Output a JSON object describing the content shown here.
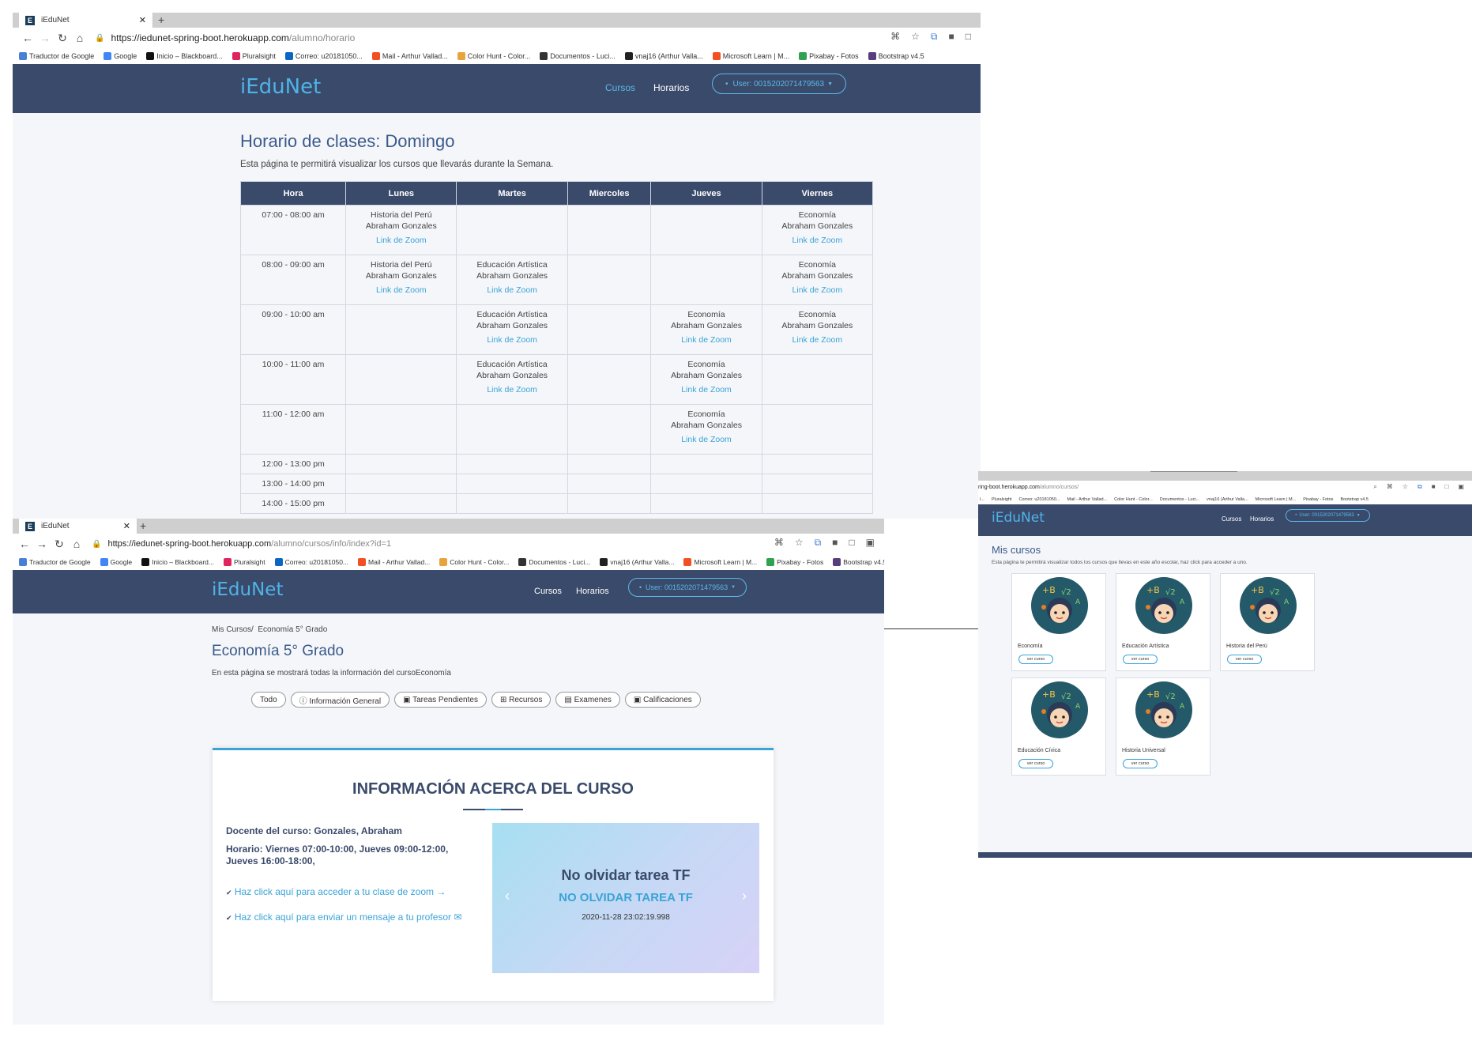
{
  "win1": {
    "tab_title": "iEduNet",
    "url_host": "https://iedunet-spring-boot.herokuapp.com",
    "url_path": "/alumno/horario",
    "bookmarks": [
      "Traductor de Google",
      "Google",
      "Inicio – Blackboard...",
      "Pluralsight",
      "Correo: u20181050...",
      "Mail - Arthur Vallad...",
      "Color Hunt - Color...",
      "Documentos - Luci...",
      "vnaj16 (Arthur Valla...",
      "Microsoft Learn | M...",
      "Pixabay - Fotos",
      "Bootstrap v4.5"
    ],
    "logo": "iEduNet",
    "nav_cursos": "Cursos",
    "nav_horarios": "Horarios",
    "user": "User: 0015202071479563",
    "title": "Horario de clases: Domingo",
    "desc": "Esta página te permitirá visualizar los cursos que llevarás durante la Semana.",
    "headers": [
      "Hora",
      "Lunes",
      "Martes",
      "Miercoles",
      "Jueves",
      "Viernes"
    ],
    "zoom_label": "Link de Zoom",
    "rows": [
      {
        "hora": "07:00 - 08:00 am",
        "cells": [
          [
            "Historia del Perú",
            "Abraham Gonzales"
          ],
          [],
          [],
          [],
          [
            "Economía",
            "Abraham Gonzales"
          ]
        ]
      },
      {
        "hora": "08:00 - 09:00 am",
        "cells": [
          [
            "Historia del Perú",
            "Abraham Gonzales"
          ],
          [
            "Educación Artística",
            "Abraham Gonzales"
          ],
          [],
          [],
          [
            "Economía",
            "Abraham Gonzales"
          ]
        ]
      },
      {
        "hora": "09:00 - 10:00 am",
        "cells": [
          [],
          [
            "Educación Artística",
            "Abraham Gonzales"
          ],
          [],
          [
            "Economía",
            "Abraham Gonzales"
          ],
          [
            "Economía",
            "Abraham Gonzales"
          ]
        ]
      },
      {
        "hora": "10:00 - 11:00 am",
        "cells": [
          [],
          [
            "Educación Artística",
            "Abraham Gonzales"
          ],
          [],
          [
            "Economía",
            "Abraham Gonzales"
          ],
          []
        ]
      },
      {
        "hora": "11:00 - 12:00 am",
        "cells": [
          [],
          [],
          [],
          [
            "Economía",
            "Abraham Gonzales"
          ],
          []
        ]
      },
      {
        "hora": "12:00 - 13:00 pm",
        "cells": [
          [],
          [],
          [],
          [],
          []
        ]
      },
      {
        "hora": "13:00 - 14:00 pm",
        "cells": [
          [],
          [],
          [],
          [],
          []
        ]
      },
      {
        "hora": "14:00 - 15:00 pm",
        "cells": [
          [],
          [],
          [],
          [],
          []
        ]
      }
    ]
  },
  "win2": {
    "tab_title": "iEduNet",
    "url_host": "https://iedunet-spring-boot.herokuapp.com",
    "url_path": "/alumno/cursos/info/index?id=1",
    "logo": "iEduNet",
    "nav_cursos": "Cursos",
    "nav_horarios": "Horarios",
    "user": "User: 0015202071479563",
    "breadcrumb": "Mis Cursos/  Economía 5° Grado",
    "title": "Economía 5° Grado",
    "desc": "En esta página se mostrará todas la información del cursoEconomía",
    "filters": [
      "Todo",
      "ⓘ Información General",
      "▣ Tareas Pendientes",
      "⊞ Recursos",
      "▤ Examenes",
      "▣ Calificaciones"
    ],
    "info_title": "INFORMACIÓN ACERCA DEL CURSO",
    "docente": "Docente del curso: Gonzales, Abraham",
    "horario": "Horario: Viernes 07:00-10:00, Jueves 09:00-12:00, Jueves 16:00-18:00,",
    "link_zoom": "Haz click aquí para acceder a tu clase de zoom →",
    "link_msg": "Haz click aquí para enviar un mensaje a tu profesor ✉",
    "slide_title": "No olvidar tarea TF",
    "slide_sub": "NO OLVIDAR TAREA TF",
    "slide_date": "2020-11-28 23:02:19.998"
  },
  "win3": {
    "url_host": "ring-boot.herokuapp.com",
    "url_path": "/alumno/cursos/",
    "logo": "iEduNet",
    "nav_cursos": "Cursos",
    "nav_horarios": "Horarios",
    "user": "User: 0015202071479563",
    "title": "Mis cursos",
    "desc": "Esta página te permitirá visualizar todos los cursos que llevas en este año escolar, haz click para acceder a uno.",
    "btn_label": "ver curso",
    "courses": [
      "Economía",
      "Educación Artística",
      "Historia del Perú",
      "Educación Cívica",
      "Historia Universal"
    ]
  },
  "colors": {
    "navbar": "#3a4a6b",
    "accent": "#3aa3d8",
    "title": "#3b5a8c"
  }
}
